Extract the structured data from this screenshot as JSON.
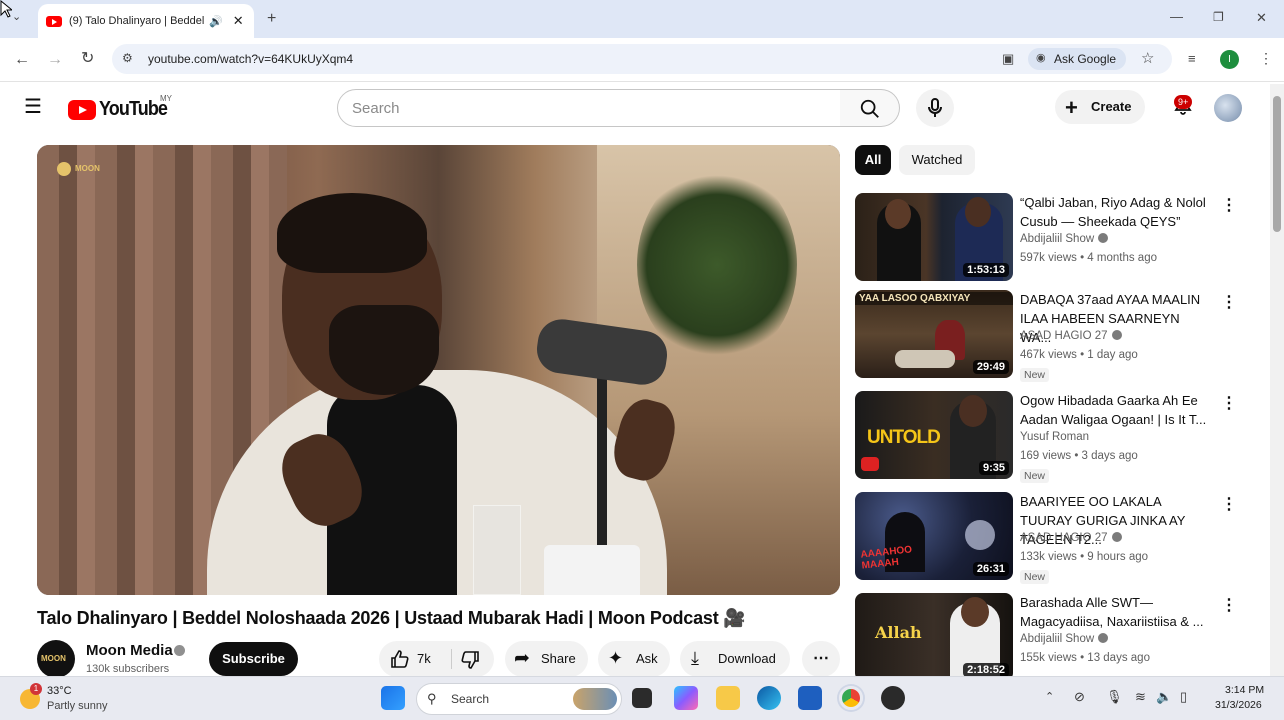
{
  "browser": {
    "tab_title": "(9) Talo Dhalinyaro | Beddel",
    "url": "youtube.com/watch?v=64KUkUyXqm4",
    "ask_google_label": "Ask Google",
    "profile_initial": "I"
  },
  "masthead": {
    "logo_text": "YouTube",
    "country_code": "MY",
    "search_placeholder": "Search",
    "create_label": "Create",
    "notification_count": "9+"
  },
  "video": {
    "title": "Talo Dhalinyaro | Beddel Noloshaada 2026 | Ustaad Mubarak Hadi | Moon Podcast 🎥",
    "watermark": "MOON",
    "channel_name": "Moon Media",
    "channel_subscribers": "130k subscribers",
    "subscribe_label": "Subscribe",
    "likes": "7k",
    "share_label": "Share",
    "ask_label": "Ask",
    "download_label": "Download"
  },
  "chips": [
    {
      "label": "All",
      "active": true
    },
    {
      "label": "Watched",
      "active": false
    }
  ],
  "related": [
    {
      "title": "“Qalbi Jaban, Riyo Adag & Nolol Cusub — Sheekada QEYS”",
      "channel": "Abdijaliil Show",
      "meta": "597k views • 4 months ago",
      "duration": "1:53:13",
      "is_new": false,
      "thumb_text": ""
    },
    {
      "title": "DABAQA 37aad AYAA MAALIN ILAA HABEEN SAARNEYN WA...",
      "channel": "ASAD HAGIO 27",
      "meta": "467k views • 1 day ago",
      "duration": "29:49",
      "is_new": true,
      "thumb_text": "YAA LASOO QABXIYAY"
    },
    {
      "title": "Ogow Hibadada Gaarka Ah Ee Aadan Waligaa Ogaan! | Is It T...",
      "channel": "Yusuf Roman",
      "meta": "169 views • 3 days ago",
      "duration": "9:35",
      "is_new": true,
      "thumb_text": "UNTOLD"
    },
    {
      "title": "BAARIYEE OO LAKALA TUURAY GURIGA JINKA AY TAGEEN T2...",
      "channel": "ASAD HAGIO 27",
      "meta": "133k views • 9 hours ago",
      "duration": "26:31",
      "is_new": true,
      "thumb_text": "AAAAHOO MAAAH"
    },
    {
      "title": "Barashada Alle SWT— Magacyadiisa, Naxariistiisa & ...",
      "channel": "Abdijaliil Show",
      "meta": "155k views • 13 days ago",
      "duration": "2:18:52",
      "is_new": false,
      "thumb_text": "Allah"
    }
  ],
  "new_badge_label": "New",
  "taskbar": {
    "weather_temp": "33°C",
    "weather_desc": "Partly sunny",
    "weather_badge": "1",
    "search_label": "Search",
    "time": "3:14 PM",
    "date": "31/3/2026"
  }
}
